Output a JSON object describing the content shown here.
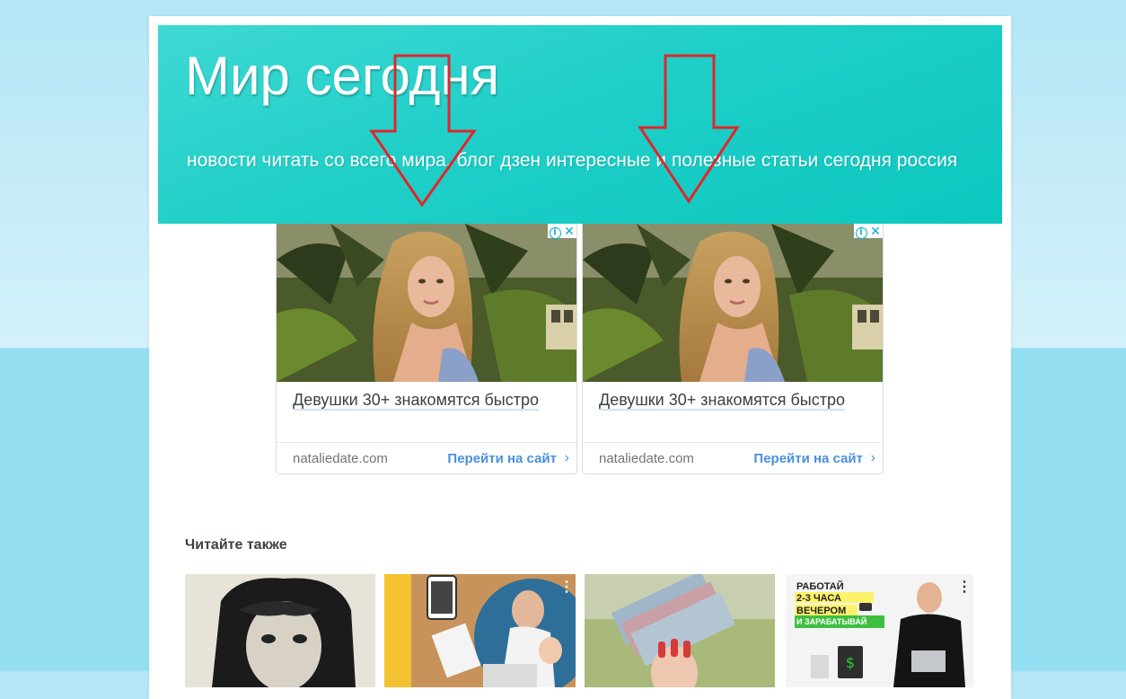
{
  "site": {
    "title": "Мир сегодня",
    "description": "новости читать со всего мира, блог дзен интересные и полезные статьи сегодня россия"
  },
  "ads": [
    {
      "title": "Девушки 30+ знакомятся быстро",
      "domain": "nataliedate.com",
      "cta": "Перейти на сайт",
      "info_icon": "i",
      "close_icon": "✕",
      "chevron": "›"
    },
    {
      "title": "Девушки 30+ знакомятся быстро",
      "domain": "nataliedate.com",
      "cta": "Перейти на сайт",
      "info_icon": "i",
      "close_icon": "✕",
      "chevron": "›"
    }
  ],
  "related": {
    "heading": "Читайте также",
    "menu_icon": "⋮",
    "thumb4": {
      "line1": "РАБОТАЙ",
      "line2": "2-3 ЧАСА",
      "line3": "ВЕЧЕРОМ",
      "line4": "И ЗАРАБАТЫВАЙ"
    }
  },
  "colors": {
    "header_start": "#3fd9d3",
    "header_end": "#0cc8c0",
    "annotation_arrow": "#e0262d",
    "ad_link": "#4a8fe0"
  }
}
